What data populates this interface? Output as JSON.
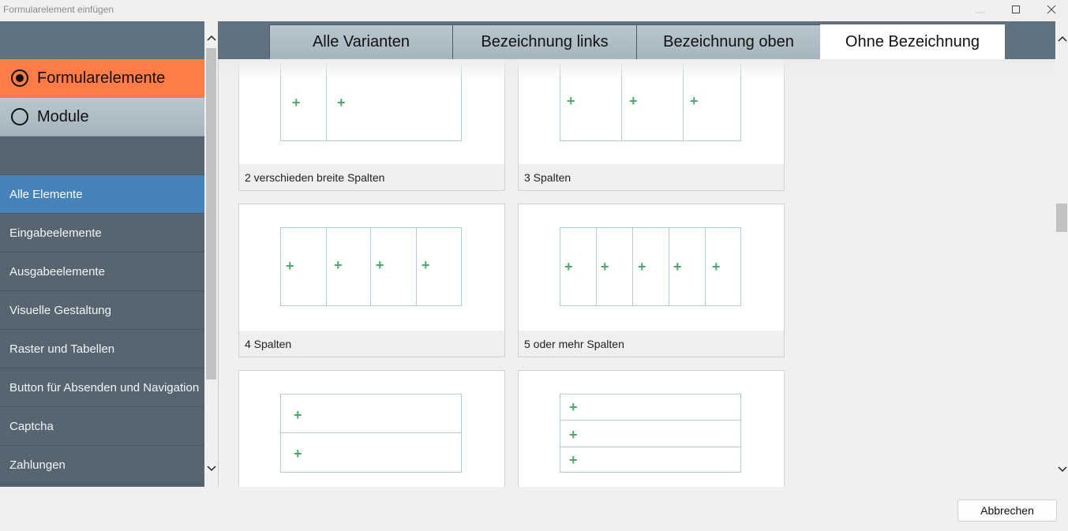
{
  "window": {
    "title": "Formularelement einfügen"
  },
  "sidebar": {
    "modes": [
      {
        "label": "Formularelemente",
        "selected": true
      },
      {
        "label": "Module",
        "selected": false
      }
    ],
    "items": [
      {
        "label": "Alle Elemente",
        "active": true
      },
      {
        "label": "Eingabeelemente"
      },
      {
        "label": "Ausgabeelemente"
      },
      {
        "label": "Visuelle Gestaltung"
      },
      {
        "label": "Raster und Tabellen"
      },
      {
        "label": "Button für Absenden und Navigation"
      },
      {
        "label": "Captcha"
      },
      {
        "label": "Zahlungen"
      }
    ]
  },
  "tabs": [
    {
      "label": "Alle Varianten"
    },
    {
      "label": "Bezeichnung links"
    },
    {
      "label": "Bezeichnung oben"
    },
    {
      "label": "Ohne Bezeichnung",
      "active": true
    }
  ],
  "cards": [
    {
      "label": "2 verschieden breite Spalten"
    },
    {
      "label": "3 Spalten"
    },
    {
      "label": "4 Spalten"
    },
    {
      "label": "5 oder mehr Spalten"
    },
    {
      "label": ""
    },
    {
      "label": ""
    }
  ],
  "footer": {
    "cancel_label": "Abbrechen"
  },
  "colors": {
    "accent": "#ff7b47",
    "nav_active": "#4683bb",
    "sidebar_bg": "#566570",
    "grid_line": "#a9d1d1",
    "plus": "#4fa86f"
  },
  "icons": [
    "minimize-icon",
    "maximize-icon",
    "close-icon",
    "chevron-up-icon",
    "chevron-down-icon",
    "plus-icon"
  ]
}
